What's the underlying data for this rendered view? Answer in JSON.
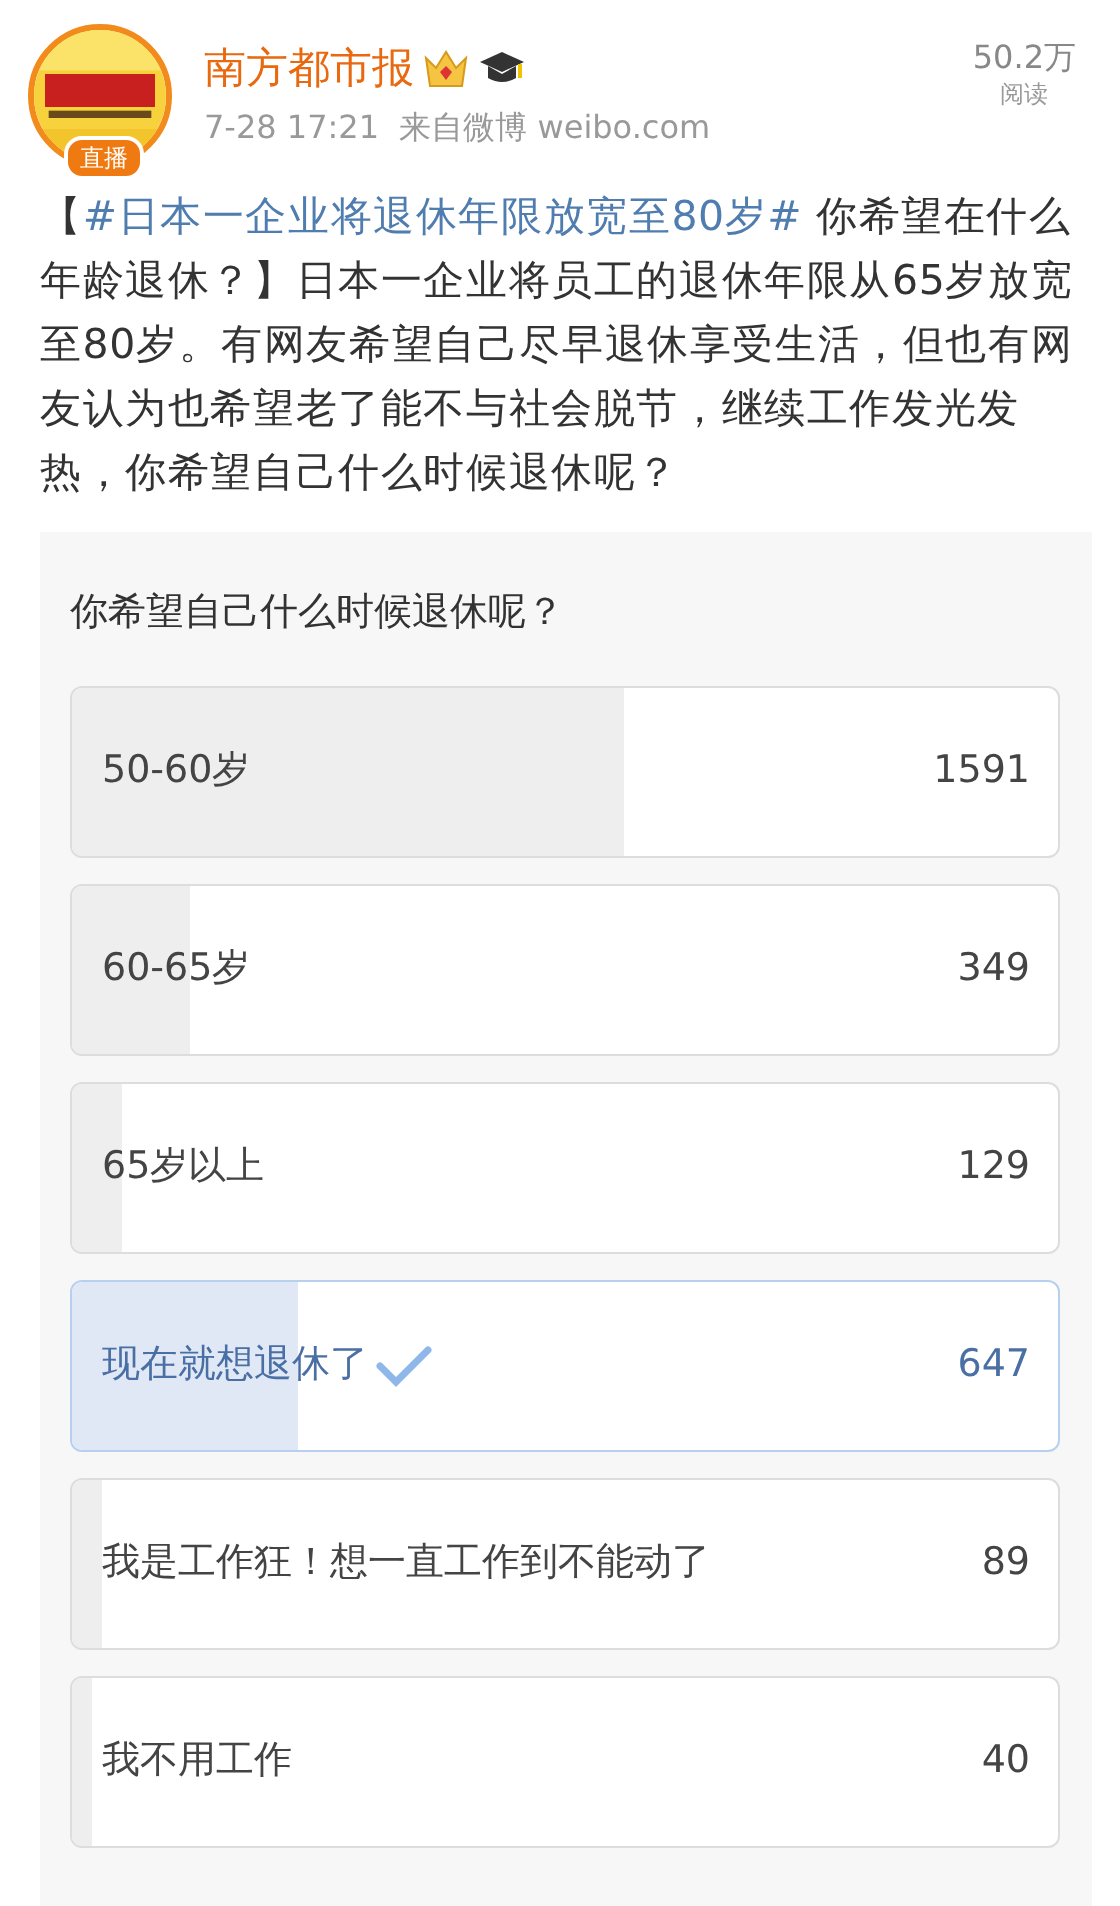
{
  "post": {
    "author": "南方都市报",
    "live_badge": "直播",
    "time": "7-28 17:21",
    "source": "来自微博 weibo.com",
    "reads": "50.2万",
    "reads_label": "阅读",
    "text_before": "【",
    "hashtag": "#日本一企业将退休年限放宽至80岁#",
    "text_after": " 你希望在什么年龄退休？】日本一企业将员工的退休年限从65岁放宽至80岁。有网友希望自己尽早退休享受生活，但也有网友认为也希望老了能不与社会脱节，继续工作发光发热，你希望自己什么时候退休呢？"
  },
  "poll": {
    "question": "你希望自己什么时候退休呢？",
    "options": [
      {
        "label": "50-60岁",
        "count": "1591",
        "level": 0.56,
        "selected": false
      },
      {
        "label": "60-65岁",
        "count": "349",
        "level": 0.12,
        "selected": false
      },
      {
        "label": "65岁以上",
        "count": "129",
        "level": 0.05,
        "selected": false
      },
      {
        "label": "现在就想退休了",
        "count": "647",
        "level": 0.23,
        "selected": true
      },
      {
        "label": "我是工作狂！想一直工作到不能动了",
        "count": "89",
        "level": 0.03,
        "selected": false
      },
      {
        "label": "我不用工作",
        "count": "40",
        "level": 0.02,
        "selected": false
      }
    ]
  }
}
